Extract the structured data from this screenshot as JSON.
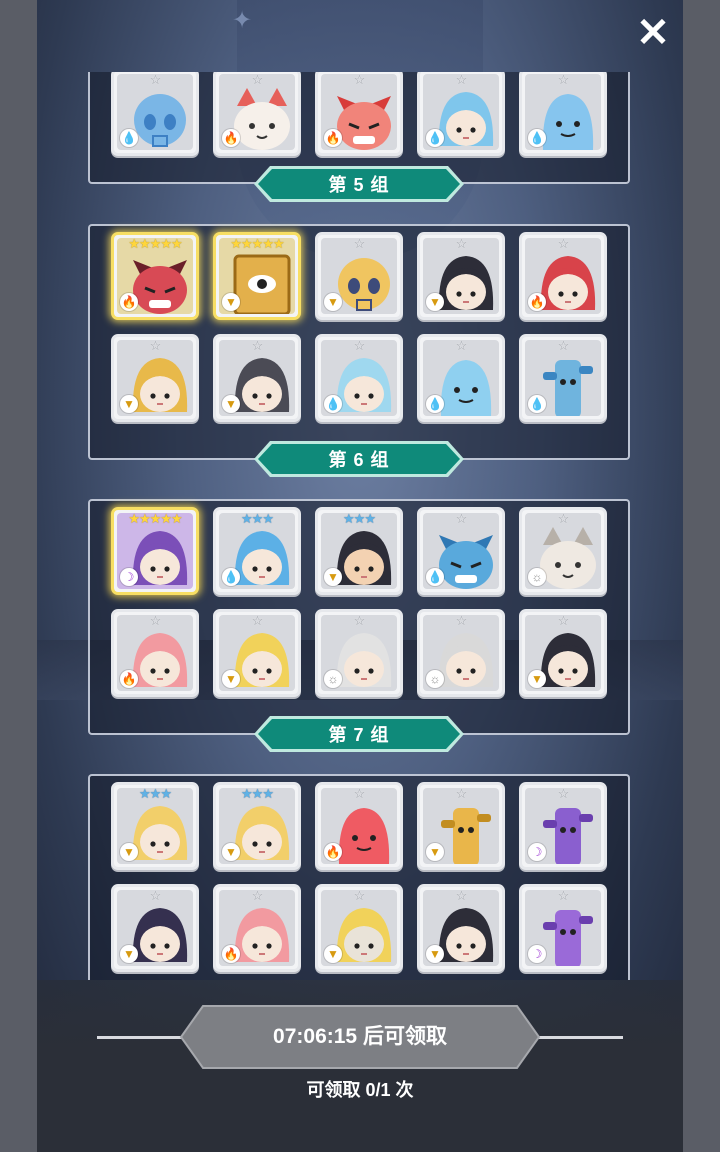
{
  "close": {
    "glyph": "✕"
  },
  "groups": [
    {
      "id": 4,
      "label": "",
      "rows": [
        [
          {
            "elem": "water",
            "stars": "☆",
            "tier": "gray",
            "skin": "#7ab6e6",
            "hair": "#3d80c4",
            "kind": "skull"
          },
          {
            "elem": "fire",
            "stars": "☆",
            "tier": "gray",
            "skin": "#f6f0ea",
            "hair": "#e6605a",
            "kind": "cat"
          },
          {
            "elem": "fire",
            "stars": "☆",
            "tier": "gray",
            "skin": "#f1847a",
            "hair": "#d83c3a",
            "kind": "beast"
          },
          {
            "elem": "water",
            "stars": "☆",
            "tier": "gray",
            "skin": "#f6e7da",
            "hair": "#7fc6ec",
            "kind": "human"
          },
          {
            "elem": "water",
            "stars": "☆",
            "tier": "gray",
            "skin": "#86c5ee",
            "hair": "#5aa7dd",
            "kind": "blob"
          }
        ]
      ]
    },
    {
      "id": 5,
      "label": "第 5 组",
      "rows": [
        [
          {
            "elem": "fire",
            "stars": "★★★★★",
            "tier": "gold",
            "skin": "#d84a55",
            "hair": "#6b1f2a",
            "kind": "beast",
            "frame": "gold"
          },
          {
            "elem": "earth",
            "stars": "★★★★★",
            "tier": "gold",
            "skin": "#e3b04b",
            "hair": "#9b6a16",
            "kind": "book",
            "frame": "gold"
          },
          {
            "elem": "earth",
            "stars": "☆",
            "tier": "gray",
            "skin": "#f0c560",
            "hair": "#3d4b7a",
            "kind": "skull"
          },
          {
            "elem": "earth",
            "stars": "☆",
            "tier": "gray",
            "skin": "#f6e7da",
            "hair": "#2d2d38",
            "kind": "human"
          },
          {
            "elem": "fire",
            "stars": "☆",
            "tier": "gray",
            "skin": "#f6e7da",
            "hair": "#d8434a",
            "kind": "human"
          }
        ],
        [
          {
            "elem": "earth",
            "stars": "☆",
            "tier": "gray",
            "skin": "#f6e7da",
            "hair": "#e8b94a",
            "kind": "human"
          },
          {
            "elem": "earth",
            "stars": "☆",
            "tier": "gray",
            "skin": "#f6e7da",
            "hair": "#4b4b55",
            "kind": "human"
          },
          {
            "elem": "water",
            "stars": "☆",
            "tier": "gray",
            "skin": "#f6e7da",
            "hair": "#9fd8ef",
            "kind": "human"
          },
          {
            "elem": "water",
            "stars": "☆",
            "tier": "gray",
            "skin": "#8fd0f0",
            "hair": "#58b1e0",
            "kind": "blob"
          },
          {
            "elem": "water",
            "stars": "☆",
            "tier": "gray",
            "skin": "#6fb4de",
            "hair": "#3b86c2",
            "kind": "totem"
          }
        ]
      ]
    },
    {
      "id": 6,
      "label": "第 6 组",
      "rows": [
        [
          {
            "elem": "dark",
            "stars": "★★★★★",
            "tier": "gold",
            "skin": "#f6e7da",
            "hair": "#7b4fb8",
            "kind": "human",
            "frame": "purple"
          },
          {
            "elem": "water",
            "stars": "★★★",
            "tier": "blue",
            "skin": "#f6e7da",
            "hair": "#5cb0e6",
            "kind": "human"
          },
          {
            "elem": "earth",
            "stars": "★★★",
            "tier": "blue",
            "skin": "#f3d2b2",
            "hair": "#2d2d38",
            "kind": "human"
          },
          {
            "elem": "water",
            "stars": "☆",
            "tier": "gray",
            "skin": "#59a9dc",
            "hair": "#2f78b4",
            "kind": "beast"
          },
          {
            "elem": "light",
            "stars": "☆",
            "tier": "gray",
            "skin": "#efe9e2",
            "hair": "#b7b0a8",
            "kind": "cat"
          }
        ],
        [
          {
            "elem": "fire",
            "stars": "☆",
            "tier": "gray",
            "skin": "#f6e7da",
            "hair": "#f29aa0",
            "kind": "human"
          },
          {
            "elem": "earth",
            "stars": "☆",
            "tier": "gray",
            "skin": "#f6e7da",
            "hair": "#f1d25a",
            "kind": "human"
          },
          {
            "elem": "light",
            "stars": "☆",
            "tier": "gray",
            "skin": "#f6e7da",
            "hair": "#e2e2e2",
            "kind": "human"
          },
          {
            "elem": "light",
            "stars": "☆",
            "tier": "gray",
            "skin": "#f6e7da",
            "hair": "#d9d9d9",
            "kind": "human"
          },
          {
            "elem": "earth",
            "stars": "☆",
            "tier": "gray",
            "skin": "#f6e7da",
            "hair": "#2d2d38",
            "kind": "human"
          }
        ]
      ]
    },
    {
      "id": 7,
      "label": "第 7 组",
      "rows": [
        [
          {
            "elem": "earth",
            "stars": "★★★",
            "tier": "blue",
            "skin": "#f6e7da",
            "hair": "#f2cf6a",
            "kind": "human"
          },
          {
            "elem": "earth",
            "stars": "★★★",
            "tier": "blue",
            "skin": "#f6e7da",
            "hair": "#f2cf6a",
            "kind": "human"
          },
          {
            "elem": "fire",
            "stars": "☆",
            "tier": "gray",
            "skin": "#ef5b63",
            "hair": "#d23e4a",
            "kind": "blob"
          },
          {
            "elem": "earth",
            "stars": "☆",
            "tier": "gray",
            "skin": "#e9b64a",
            "hair": "#c28d20",
            "kind": "totem"
          },
          {
            "elem": "dark",
            "stars": "☆",
            "tier": "gray",
            "skin": "#8a5fcf",
            "hair": "#6a3fae",
            "kind": "totem"
          }
        ],
        [
          {
            "elem": "earth",
            "stars": "☆",
            "tier": "gray",
            "skin": "#f6e7da",
            "hair": "#35304f",
            "kind": "human"
          },
          {
            "elem": "fire",
            "stars": "☆",
            "tier": "gray",
            "skin": "#f6e7da",
            "hair": "#f29aa0",
            "kind": "human"
          },
          {
            "elem": "earth",
            "stars": "☆",
            "tier": "gray",
            "skin": "#e9e3d8",
            "hair": "#f1d25a",
            "kind": "human"
          },
          {
            "elem": "earth",
            "stars": "☆",
            "tier": "gray",
            "skin": "#f6e7da",
            "hair": "#2d2d38",
            "kind": "human"
          },
          {
            "elem": "dark",
            "stars": "☆",
            "tier": "gray",
            "skin": "#9a6ad8",
            "hair": "#6a3fae",
            "kind": "totem"
          }
        ]
      ]
    }
  ],
  "element_glyphs": {
    "water": "💧",
    "fire": "🔥",
    "earth": "▼",
    "light": "☼",
    "dark": "☽"
  },
  "claim": {
    "timer_text": "07:06:15 后可领取",
    "count_text": "可领取 0/1 次"
  },
  "colors": {
    "banner": "#0f8a7a",
    "banner_edge": "#bfe9df",
    "claim_button": "#7d7f84"
  }
}
